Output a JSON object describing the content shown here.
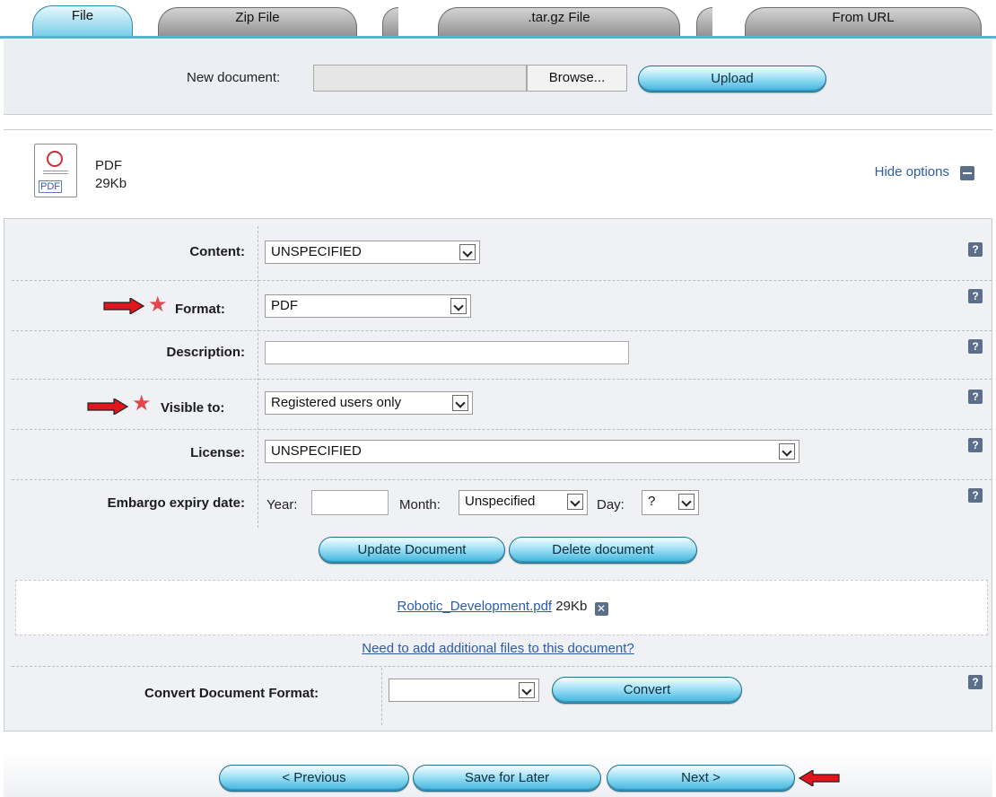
{
  "tabs": [
    {
      "label": "File",
      "active": true
    },
    {
      "label": "Zip File",
      "active": false
    },
    {
      "label": ".tar.gz File",
      "active": false
    },
    {
      "label": "From URL",
      "active": false
    }
  ],
  "upload": {
    "new_document_label": "New document:",
    "file_value": "",
    "browse_label": "Browse...",
    "upload_label": "Upload"
  },
  "document": {
    "icon_tag": "PDF",
    "type": "PDF",
    "size": "29Kb",
    "hide_options_label": "Hide options"
  },
  "form": {
    "content": {
      "label": "Content:",
      "value": "UNSPECIFIED"
    },
    "format": {
      "label": "Format:",
      "value": "PDF",
      "required": true
    },
    "description": {
      "label": "Description:",
      "value": ""
    },
    "visible_to": {
      "label": "Visible to:",
      "value": "Registered users only",
      "required": true
    },
    "license": {
      "label": "License:",
      "value": "UNSPECIFIED"
    },
    "embargo": {
      "label": "Embargo expiry date:",
      "year_label": "Year:",
      "year_value": "",
      "month_label": "Month:",
      "month_value": "Unspecified",
      "day_label": "Day:",
      "day_value": "?"
    },
    "help_glyph": "?"
  },
  "actions": {
    "update_label": "Update Document",
    "delete_label": "Delete document"
  },
  "file": {
    "name": "Robotic_Development.pdf",
    "size": "29Kb",
    "remove_glyph": "✕"
  },
  "add_files_link": "Need to add additional files to this document?",
  "convert": {
    "label": "Convert Document Format:",
    "value": "",
    "button_label": "Convert"
  },
  "nav": {
    "previous_label": "< Previous",
    "save_label": "Save for Later",
    "next_label": "Next >"
  },
  "colors": {
    "accent": "#55b7d6",
    "button": "#3ab2dc",
    "annotation_arrow": "#e0161c",
    "required_star": "#e0484e",
    "link": "#2a5caa"
  }
}
